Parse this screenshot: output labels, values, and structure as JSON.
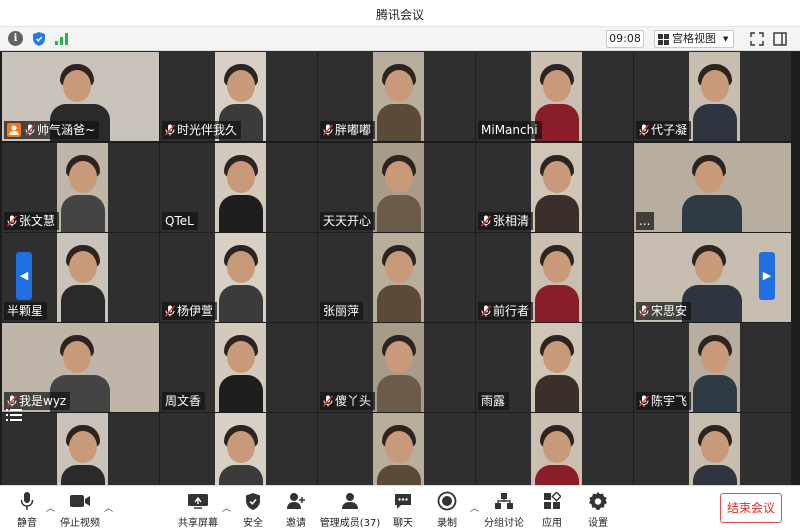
{
  "window": {
    "title": "腾讯会议"
  },
  "toolbar": {
    "time": "09:08",
    "view_label": "宫格视图",
    "icons": [
      "info-icon",
      "shield-icon",
      "signal-icon",
      "fullscreen-icon",
      "side-panel-icon"
    ]
  },
  "participants": [
    {
      "name": "帅气涵爸~"
    },
    {
      "name": "时光伴我久"
    },
    {
      "name": "胖嘟嘟"
    },
    {
      "name": "MiManchi"
    },
    {
      "name": "代子凝"
    },
    {
      "name": "张文慧"
    },
    {
      "name": "QTeL"
    },
    {
      "name": "天天开心"
    },
    {
      "name": "张相清"
    },
    {
      "name": "..."
    },
    {
      "name": "半颗星"
    },
    {
      "name": "杨伊萱"
    },
    {
      "name": "张丽萍"
    },
    {
      "name": "前行者"
    },
    {
      "name": "宋思安"
    },
    {
      "name": "我是wyz"
    },
    {
      "name": "周文香"
    },
    {
      "name": "傻丫头"
    },
    {
      "name": "雨露"
    },
    {
      "name": "陈宇飞"
    }
  ],
  "bottom": {
    "mute": "静音",
    "stop_video": "停止视频",
    "share": "共享屏幕",
    "security": "安全",
    "invite": "邀请",
    "manage": "管理成员(37)",
    "chat": "聊天",
    "record": "录制",
    "breakout": "分组讨论",
    "apps": "应用",
    "settings": "设置",
    "end": "结束会议"
  },
  "colors": {
    "accent": "#1f6fe0",
    "end_red": "#e02d2d",
    "host_badge": "#f07b1a"
  }
}
